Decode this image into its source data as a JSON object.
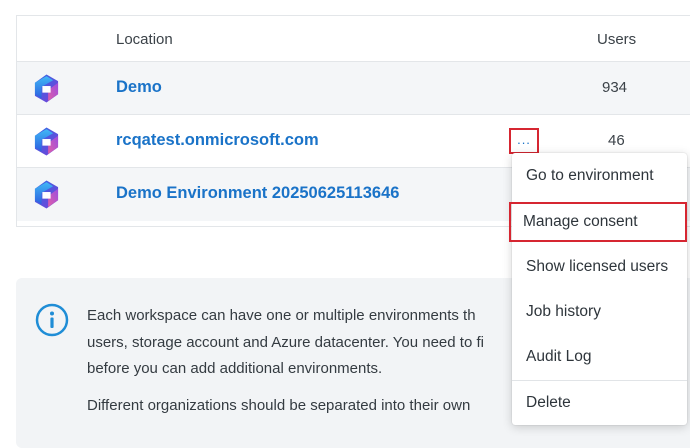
{
  "table": {
    "headers": {
      "location": "Location",
      "users": "Users"
    },
    "rows": [
      {
        "name": "Demo",
        "users": "934"
      },
      {
        "name": "rcqatest.onmicrosoft.com",
        "users": "46"
      },
      {
        "name": "Demo Environment 20250625113646",
        "users": ""
      }
    ],
    "more_label": "..."
  },
  "info": {
    "line1": "Each workspace can have one or multiple environments th",
    "line2": "users, storage account and Azure datacenter. You need to fi",
    "line3": "before you can add additional environments.",
    "line4": "Different organizations should be separated into their own"
  },
  "menu": {
    "items": [
      "Go to environment",
      "Manage consent",
      "Show licensed users",
      "Job history",
      "Audit Log",
      "Delete"
    ]
  },
  "colors": {
    "link": "#1a73c8",
    "highlight_border": "#d62631",
    "info_icon": "#1f8dd6"
  }
}
